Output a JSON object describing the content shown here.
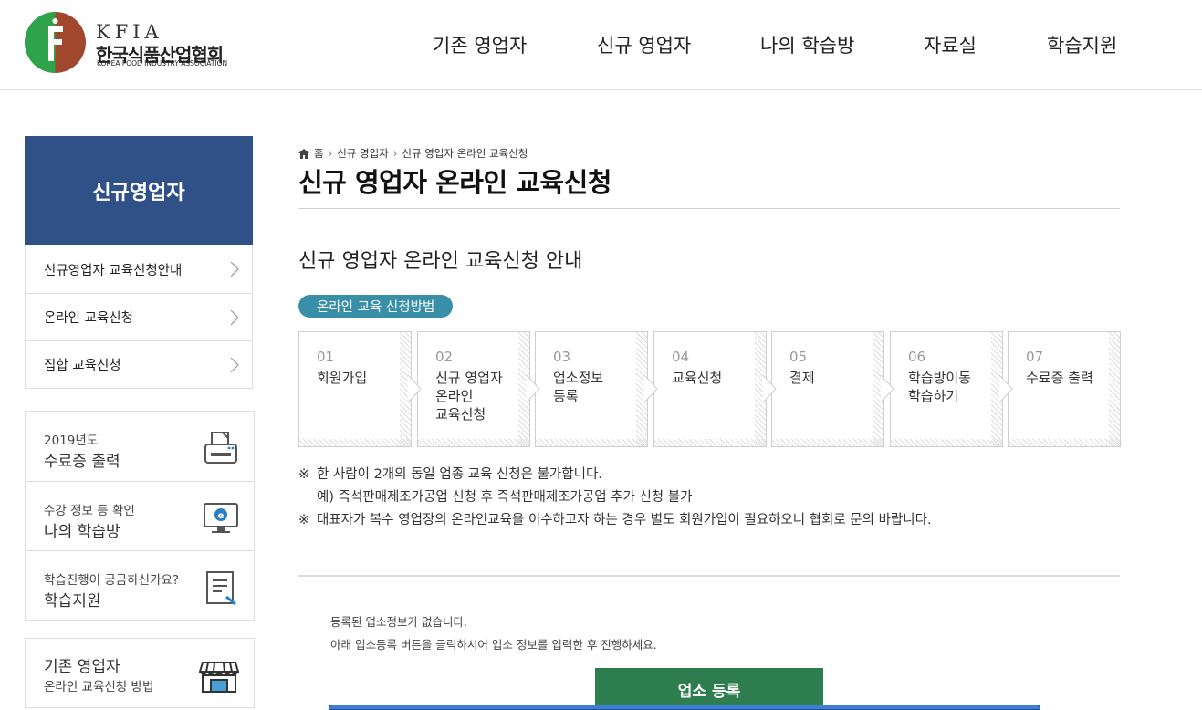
{
  "header": {
    "logo": {
      "en": "KFIA",
      "ko": "한국식품산업협회",
      "sub": "KOREA FOOD INDUSTRY ASSOCIATION"
    },
    "nav": [
      "기존 영업자",
      "신규 영업자",
      "나의 학습방",
      "자료실",
      "학습지원"
    ]
  },
  "sidebar": {
    "title": "신규영업자",
    "menu": [
      "신규영업자 교육신청안내",
      "온라인 교육신청",
      "집합 교육신청"
    ],
    "quick": [
      {
        "small": "2019년도",
        "large": "수료증 출력",
        "icon": "printer-icon"
      },
      {
        "small": "수강 정보 등 확인",
        "large": "나의 학습방",
        "icon": "monitor-icon"
      },
      {
        "small": "학습진행이 궁금하신가요?",
        "large": "학습지원",
        "icon": "document-icon"
      }
    ],
    "existing": {
      "large": "기존 영업자",
      "small": "온라인 교육신청 방법",
      "icon": "store-icon"
    }
  },
  "breadcrumb": [
    "홈",
    "신규 영업자",
    "신규 영업자 온라인 교육신청"
  ],
  "page": {
    "title": "신규 영업자 온라인 교육신청",
    "subtitle": "신규 영업자 온라인 교육신청 안내",
    "method_label": "온라인 교육 신청방법"
  },
  "steps": [
    {
      "num": "01",
      "label": "회원가입"
    },
    {
      "num": "02",
      "label": "신규 영업자\n온라인\n교육신청"
    },
    {
      "num": "03",
      "label": "업소정보\n등록"
    },
    {
      "num": "04",
      "label": "교육신청"
    },
    {
      "num": "05",
      "label": "결제"
    },
    {
      "num": "06",
      "label": "학습방이동\n학습하기"
    },
    {
      "num": "07",
      "label": "수료증 출력"
    }
  ],
  "notes": {
    "mark": "※",
    "line1": "한 사람이 2개의 동일 업종 교육 신청은 불가합니다.",
    "line2": "예) 즉석판매제조가공업 신청 후 즉석판매제조가공업 추가 신청 불가",
    "line3": "대표자가 복수 영업장의 온라인교육을 이수하고자 하는 경우 별도 회원가입이 필요하오니 협회로 문의 바랍니다."
  },
  "message": {
    "line1": "등록된 업소정보가 없습니다.",
    "line2": "아래 업소등록 버튼을 클릭하시어 업소 정보를 입력한 후 진행하세요."
  },
  "register_button": "업소 등록",
  "colors": {
    "brand_blue": "#2f5188",
    "pill": "#3a8fa8",
    "button_green": "#2e7d4f",
    "logo_green": "#2fa34a",
    "logo_brown": "#a0472e"
  }
}
